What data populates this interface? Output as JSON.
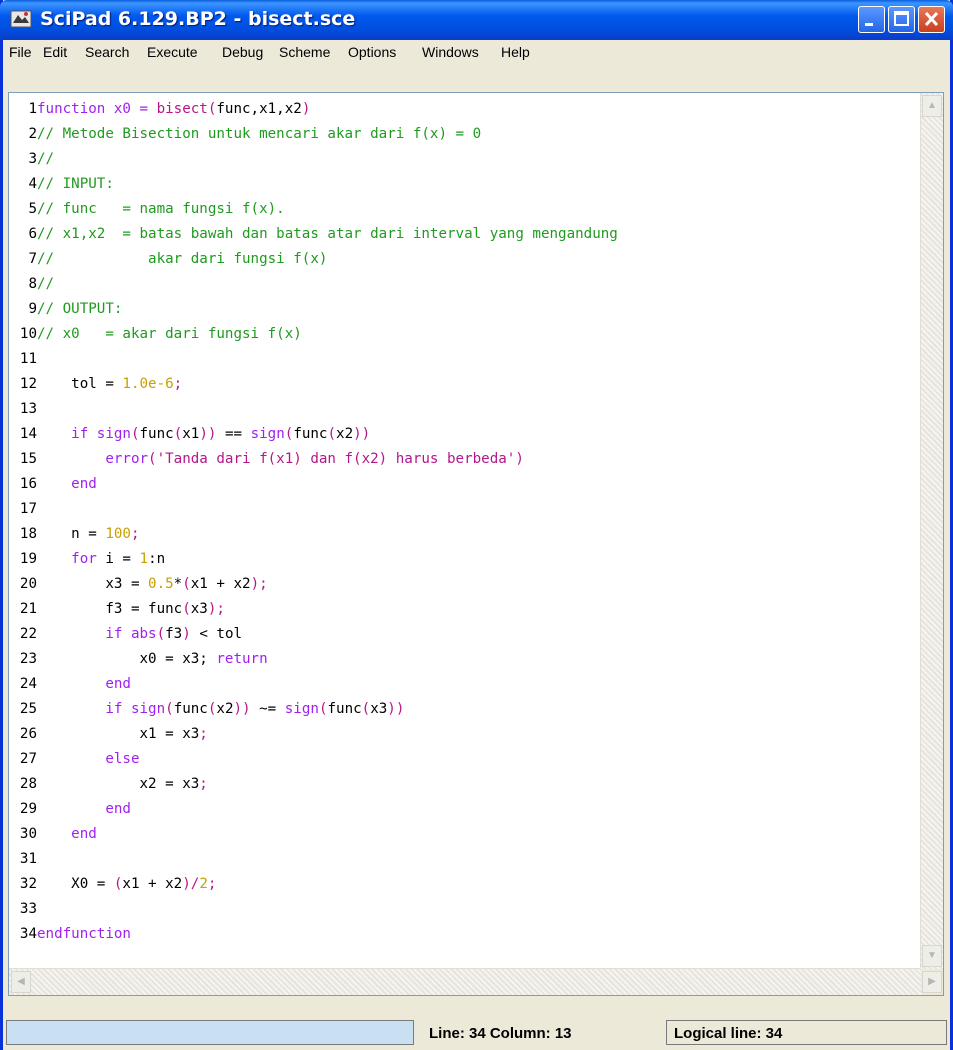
{
  "window": {
    "title": "SciPad 6.129.BP2 - bisect.sce"
  },
  "menu": [
    "File",
    "Edit",
    "Search",
    "Execute",
    "Debug",
    "Scheme",
    "Options",
    "Windows",
    "Help"
  ],
  "colors": {
    "keyword": "#a020f0",
    "comment": "#1f9b1f",
    "number": "#c8a000",
    "string": "#b5178a",
    "paren": "#b5178a",
    "text": "#000000"
  },
  "code": [
    {
      "n": "1",
      "tokens": [
        [
          "function x0 = ",
          "kw"
        ],
        [
          "bisect",
          "str"
        ],
        [
          "(",
          "par"
        ],
        [
          "func,x1,x2",
          ""
        ],
        [
          ")",
          "par"
        ]
      ]
    },
    {
      "n": "2",
      "tokens": [
        [
          "// Metode Bisection untuk mencari akar dari f(x) = 0",
          "cm"
        ]
      ]
    },
    {
      "n": "3",
      "tokens": [
        [
          "//",
          "cm"
        ]
      ]
    },
    {
      "n": "4",
      "tokens": [
        [
          "// INPUT:",
          "cm"
        ]
      ]
    },
    {
      "n": "5",
      "tokens": [
        [
          "// func   = nama fungsi f(x).",
          "cm"
        ]
      ]
    },
    {
      "n": "6",
      "tokens": [
        [
          "// x1,x2  = batas bawah dan batas atar dari interval yang mengandung",
          "cm"
        ]
      ]
    },
    {
      "n": "7",
      "tokens": [
        [
          "//           akar dari fungsi f(x)",
          "cm"
        ]
      ]
    },
    {
      "n": "8",
      "tokens": [
        [
          "//",
          "cm"
        ]
      ]
    },
    {
      "n": "9",
      "tokens": [
        [
          "// OUTPUT:",
          "cm"
        ]
      ]
    },
    {
      "n": "10",
      "tokens": [
        [
          "// x0   = akar dari fungsi f(x)",
          "cm"
        ]
      ]
    },
    {
      "n": "11",
      "tokens": []
    },
    {
      "n": "12",
      "tokens": [
        [
          "    tol = ",
          ""
        ],
        [
          "1.0e-6",
          "num"
        ],
        [
          ";",
          "par"
        ]
      ]
    },
    {
      "n": "13",
      "tokens": []
    },
    {
      "n": "14",
      "tokens": [
        [
          "    ",
          ""
        ],
        [
          "if ",
          "kw"
        ],
        [
          "sign",
          "kw"
        ],
        [
          "(",
          "par"
        ],
        [
          "func",
          ""
        ],
        [
          "(",
          "par"
        ],
        [
          "x1",
          ""
        ],
        [
          "))",
          "par"
        ],
        [
          " == ",
          ""
        ],
        [
          "sign",
          "kw"
        ],
        [
          "(",
          "par"
        ],
        [
          "func",
          ""
        ],
        [
          "(",
          "par"
        ],
        [
          "x2",
          ""
        ],
        [
          "))",
          "par"
        ]
      ]
    },
    {
      "n": "15",
      "tokens": [
        [
          "        error",
          "kw"
        ],
        [
          "(",
          "par"
        ],
        [
          "'Tanda dari f(x1) dan f(x2) harus berbeda'",
          "str"
        ],
        [
          ")",
          "par"
        ]
      ]
    },
    {
      "n": "16",
      "tokens": [
        [
          "    ",
          ""
        ],
        [
          "end",
          "kw"
        ]
      ]
    },
    {
      "n": "17",
      "tokens": []
    },
    {
      "n": "18",
      "tokens": [
        [
          "    n = ",
          ""
        ],
        [
          "100",
          "num"
        ],
        [
          ";",
          "par"
        ]
      ]
    },
    {
      "n": "19",
      "tokens": [
        [
          "    ",
          ""
        ],
        [
          "for ",
          "kw"
        ],
        [
          "i = ",
          ""
        ],
        [
          "1",
          "num"
        ],
        [
          ":",
          ""
        ],
        [
          "n",
          ""
        ]
      ]
    },
    {
      "n": "20",
      "tokens": [
        [
          "        x3 = ",
          ""
        ],
        [
          "0.5",
          "num"
        ],
        [
          "*",
          ""
        ],
        [
          "(",
          "par"
        ],
        [
          "x1 + x2",
          ""
        ],
        [
          ")",
          "par"
        ],
        [
          ";",
          "par"
        ]
      ]
    },
    {
      "n": "21",
      "tokens": [
        [
          "        f3 = func",
          ""
        ],
        [
          "(",
          "par"
        ],
        [
          "x3",
          ""
        ],
        [
          ")",
          "par"
        ],
        [
          ";",
          "par"
        ]
      ]
    },
    {
      "n": "22",
      "tokens": [
        [
          "        ",
          ""
        ],
        [
          "if ",
          "kw"
        ],
        [
          "abs",
          "kw"
        ],
        [
          "(",
          "par"
        ],
        [
          "f3",
          ""
        ],
        [
          ")",
          "par"
        ],
        [
          " < tol",
          ""
        ]
      ]
    },
    {
      "n": "23",
      "tokens": [
        [
          "            x0 = x3; ",
          ""
        ],
        [
          "return",
          "kw"
        ]
      ]
    },
    {
      "n": "24",
      "tokens": [
        [
          "        ",
          ""
        ],
        [
          "end",
          "kw"
        ]
      ]
    },
    {
      "n": "25",
      "tokens": [
        [
          "        ",
          ""
        ],
        [
          "if ",
          "kw"
        ],
        [
          "sign",
          "kw"
        ],
        [
          "(",
          "par"
        ],
        [
          "func",
          ""
        ],
        [
          "(",
          "par"
        ],
        [
          "x2",
          ""
        ],
        [
          "))",
          "par"
        ],
        [
          " ~= ",
          ""
        ],
        [
          "sign",
          "kw"
        ],
        [
          "(",
          "par"
        ],
        [
          "func",
          ""
        ],
        [
          "(",
          "par"
        ],
        [
          "x3",
          ""
        ],
        [
          "))",
          "par"
        ]
      ]
    },
    {
      "n": "26",
      "tokens": [
        [
          "            x1 = x3",
          ""
        ],
        [
          ";",
          "par"
        ]
      ]
    },
    {
      "n": "27",
      "tokens": [
        [
          "        ",
          ""
        ],
        [
          "else",
          "kw"
        ]
      ]
    },
    {
      "n": "28",
      "tokens": [
        [
          "            x2 = x3",
          ""
        ],
        [
          ";",
          "par"
        ]
      ]
    },
    {
      "n": "29",
      "tokens": [
        [
          "        ",
          ""
        ],
        [
          "end",
          "kw"
        ]
      ]
    },
    {
      "n": "30",
      "tokens": [
        [
          "    ",
          ""
        ],
        [
          "end",
          "kw"
        ]
      ]
    },
    {
      "n": "31",
      "tokens": []
    },
    {
      "n": "32",
      "tokens": [
        [
          "    X0 = ",
          ""
        ],
        [
          "(",
          "par"
        ],
        [
          "x1 + x2",
          ""
        ],
        [
          ")",
          "par"
        ],
        [
          "/",
          "par"
        ],
        [
          "2",
          "num"
        ],
        [
          ";",
          "par"
        ]
      ]
    },
    {
      "n": "33",
      "tokens": []
    },
    {
      "n": "34",
      "tokens": [
        [
          "endfunction",
          "kw"
        ]
      ]
    }
  ],
  "status": {
    "line_column": "Line: 34 Column: 13",
    "logical_line": "Logical line: 34"
  }
}
